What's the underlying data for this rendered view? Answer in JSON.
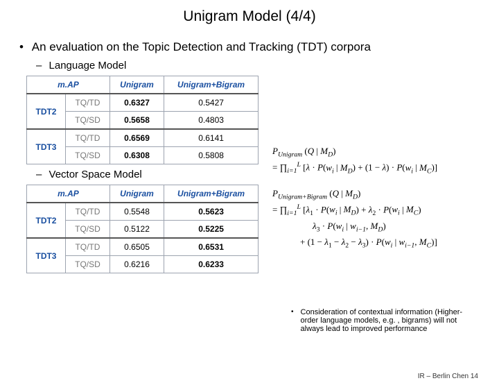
{
  "title": "Unigram Model (4/4)",
  "main_bullet": "An evaluation on the Topic Detection and Tracking (TDT) corpora",
  "sub_bullets": {
    "lm": "Language Model",
    "vsm": "Vector Space Model"
  },
  "table_headers": {
    "map": "m.AP",
    "unigram": "Unigram",
    "ub": "Unigram+Bigram"
  },
  "rowlabels": {
    "tdt2": "TDT2",
    "tdt3": "TDT3",
    "tqtd": "TQ/TD",
    "tqsd": "TQ/SD"
  },
  "lm_data": {
    "r1": {
      "u": "0.6327",
      "ub": "0.5427"
    },
    "r2": {
      "u": "0.5658",
      "ub": "0.4803"
    },
    "r3": {
      "u": "0.6569",
      "ub": "0.6141"
    },
    "r4": {
      "u": "0.6308",
      "ub": "0.5808"
    }
  },
  "vsm_data": {
    "r1": {
      "u": "0.5548",
      "ub": "0.5623"
    },
    "r2": {
      "u": "0.5122",
      "ub": "0.5225"
    },
    "r3": {
      "u": "0.6505",
      "ub": "0.6531"
    },
    "r4": {
      "u": "0.6216",
      "ub": "0.6233"
    }
  },
  "formulas": {
    "f1a": "P_Unigram (Q | M_D)",
    "f1b": "= ∏_{i=1}^{L} [ λ · P(w_i | M_D) + (1 − λ) · P(w_i | M_C) ]",
    "f2a": "P_Unigram+Bigram (Q | M_D)",
    "f2b": "= ∏_{i=1}^{L} [ λ_1 · P(w_i | M_D) + λ_2 · P(w_i | M_C)",
    "f2c": "λ_3 · P(w_i | w_{i−1}, M_D)",
    "f2d": "+ (1 − λ_1 − λ_2 − λ_3) · P(w_i | w_{i−1}, M_C) ]"
  },
  "consideration": "Consideration of contextual information (Higher-order language models, e.g. , bigrams) will not always lead to improved performance",
  "footer": "IR – Berlin Chen 14"
}
